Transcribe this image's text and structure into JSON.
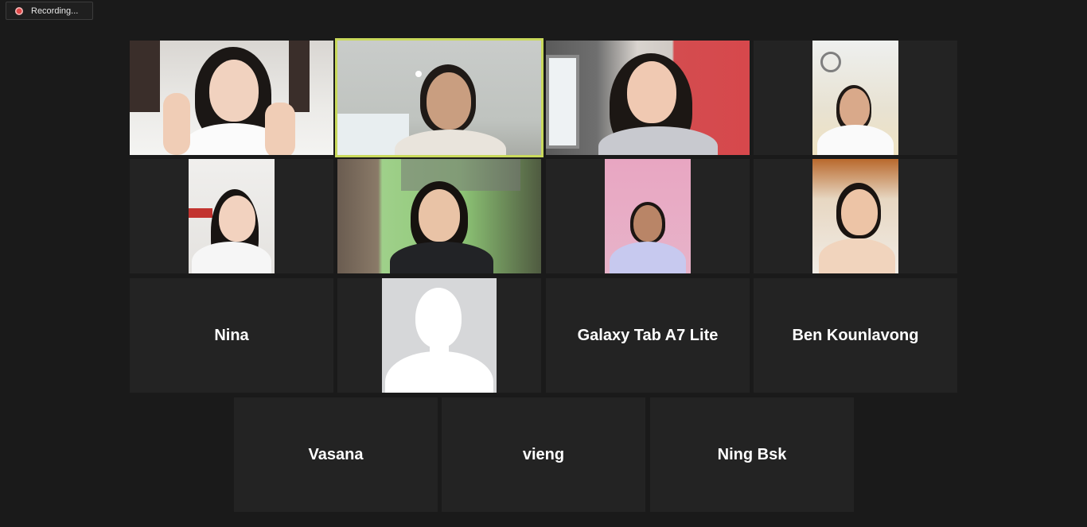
{
  "recording": {
    "label": "Recording..."
  },
  "participants": [
    {
      "id": "p1",
      "type": "video"
    },
    {
      "id": "p2",
      "type": "video",
      "speaking": true
    },
    {
      "id": "p3",
      "type": "video"
    },
    {
      "id": "p4",
      "type": "video"
    },
    {
      "id": "p5",
      "type": "video"
    },
    {
      "id": "p6",
      "type": "video"
    },
    {
      "id": "p7",
      "type": "video"
    },
    {
      "id": "p8",
      "type": "video"
    },
    {
      "id": "p9",
      "type": "name",
      "name": "Nina"
    },
    {
      "id": "p10",
      "type": "avatar"
    },
    {
      "id": "p11",
      "type": "name",
      "name": "Galaxy Tab A7 Lite"
    },
    {
      "id": "p12",
      "type": "name",
      "name": "Ben Kounlavong"
    },
    {
      "id": "p13",
      "type": "name",
      "name": "Vasana"
    },
    {
      "id": "p14",
      "type": "name",
      "name": "vieng"
    },
    {
      "id": "p15",
      "type": "name",
      "name": "Ning Bsk"
    }
  ]
}
